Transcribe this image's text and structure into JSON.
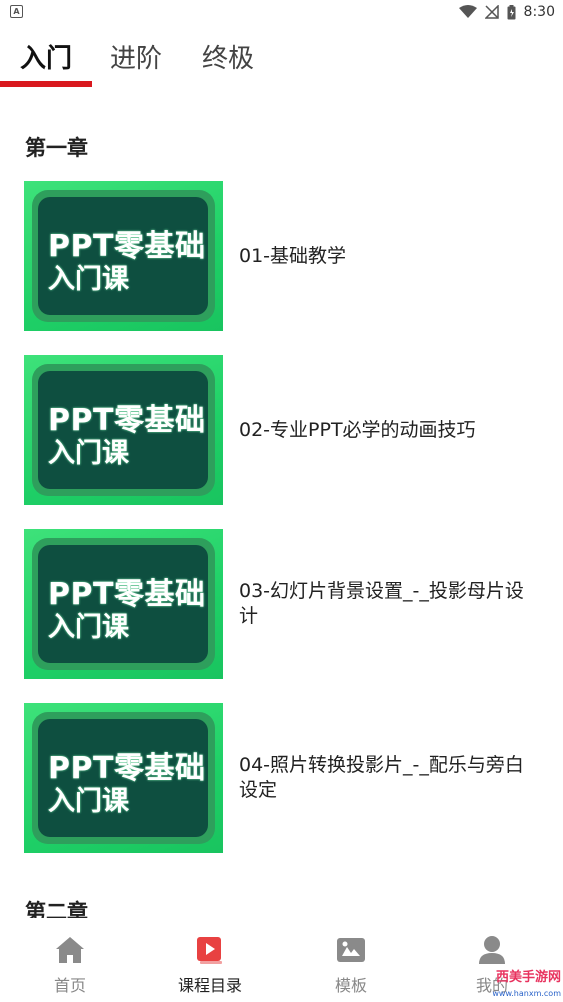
{
  "status_bar": {
    "time": "8:30"
  },
  "tabs": [
    {
      "label": "入门"
    },
    {
      "label": "进阶"
    },
    {
      "label": "终极"
    }
  ],
  "chapters": [
    {
      "title": "第一章"
    },
    {
      "title": "第二章"
    }
  ],
  "lessons": [
    {
      "title": "01-基础教学",
      "thumb_line1": "PPT零基础",
      "thumb_line2": "入门课"
    },
    {
      "title": "02-专业PPT必学的动画技巧",
      "thumb_line1": "PPT零基础",
      "thumb_line2": "入门课"
    },
    {
      "title": "03-幻灯片背景设置_-_投影母片设计",
      "thumb_line1": "PPT零基础",
      "thumb_line2": "入门课"
    },
    {
      "title": "04-照片转换投影片_-_配乐与旁白设定",
      "thumb_line1": "PPT零基础",
      "thumb_line2": "入门课"
    }
  ],
  "bottom_nav": [
    {
      "label": "首页",
      "icon": "home-icon"
    },
    {
      "label": "课程目录",
      "icon": "course-catalog-icon"
    },
    {
      "label": "模板",
      "icon": "template-icon"
    },
    {
      "label": "我的",
      "icon": "profile-icon"
    }
  ],
  "watermark": {
    "brand": "西美手游网",
    "url": "www.hanxm.com"
  },
  "colors": {
    "accent": "#d9181e",
    "thumb_green": "#1fd067",
    "thumb_dark": "#0e4f40"
  }
}
